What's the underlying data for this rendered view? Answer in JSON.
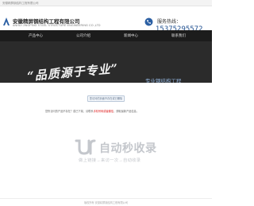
{
  "topbar": {
    "text": "安徽精屏钢结构工程有限公司"
  },
  "header": {
    "company_name": "安徽精屏钢结构工程有限公司",
    "company_en": "ANHUI JINGPING STEEL STRUCTURE ENGINEERING CO.,LTD",
    "hotline_label": "服务热线：",
    "phone": "15375295572"
  },
  "nav": {
    "items": [
      {
        "label": "产品中心"
      },
      {
        "label": "公司介绍"
      },
      {
        "label": "新闻中心"
      },
      {
        "label": "联系我们"
      }
    ]
  },
  "banner": {
    "calligraphy": "“品质源于专业”",
    "slogan": "专业钢结构工程"
  },
  "content": {
    "error_message": "您访问的页面不存在或已删除",
    "desc_before": "您所访问的产品不存在？或已下架，请联系",
    "desc_highlight": "手机号码或者微信",
    "desc_after": "，获取最新产品信息。"
  },
  "watermark": {
    "brand": "自动秒收录",
    "slogan": "做上链接→来访一次→自动收录"
  },
  "footer": {
    "text": "版权所有 安徽精屏钢结构工程有限公司"
  },
  "colors": {
    "nav_bg": "#1c1c1c",
    "banner_bg": "#2b2b2b",
    "phone": "#1f4f8f",
    "highlight": "#dd1111",
    "watermark": "#c4c7cc"
  }
}
